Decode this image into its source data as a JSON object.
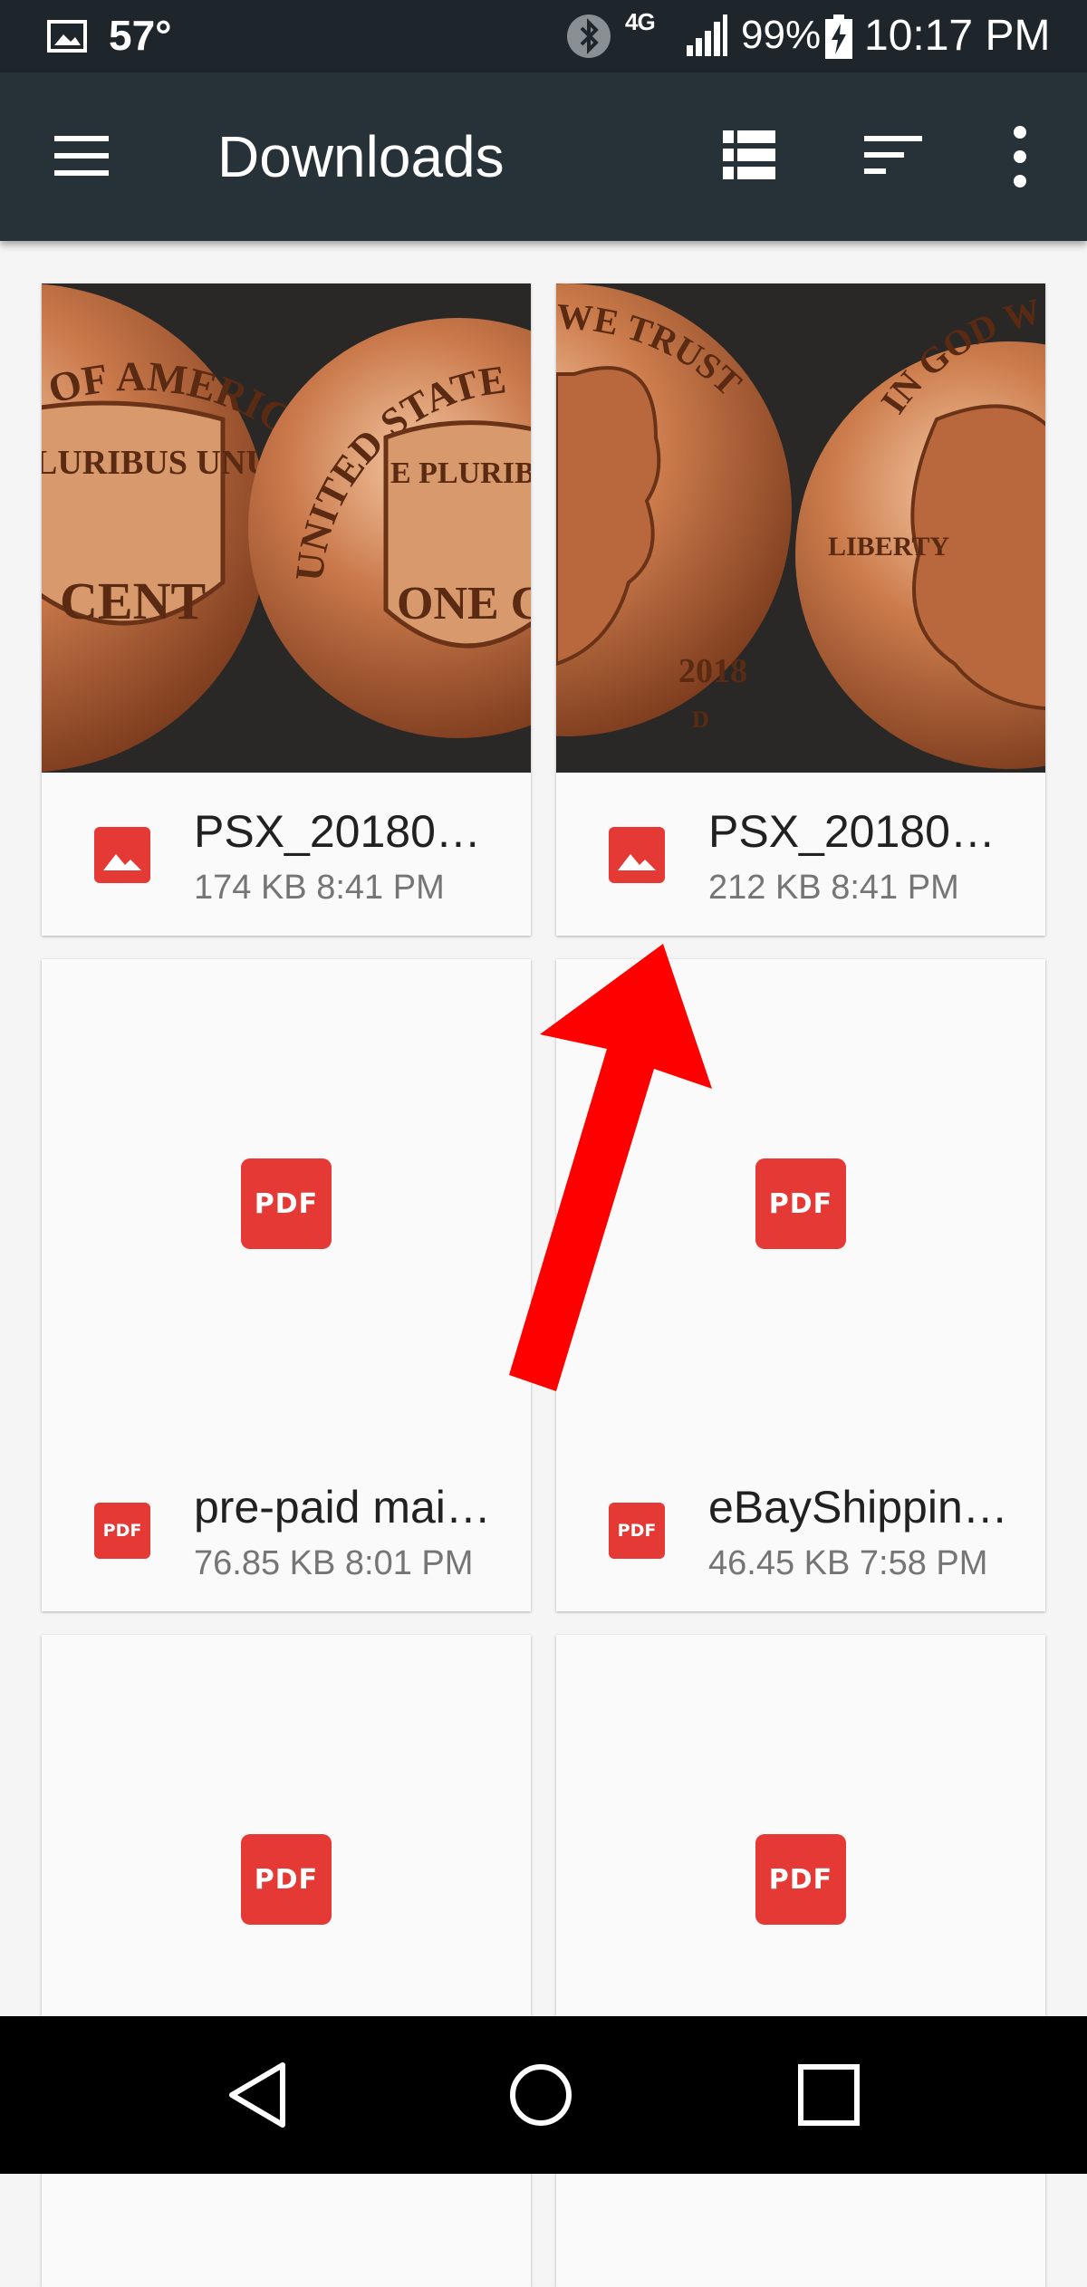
{
  "status_bar": {
    "temperature": "57°",
    "network": "4G",
    "battery_pct": "99%",
    "time": "10:17 PM",
    "icons": [
      "image-icon",
      "bluetooth-icon",
      "signal-icon",
      "battery-charging-icon"
    ]
  },
  "app_bar": {
    "title": "Downloads",
    "icons": [
      "menu-icon",
      "list-view-icon",
      "sort-icon",
      "more-vert-icon"
    ]
  },
  "files": [
    {
      "name": "PSX_20180…",
      "size": "174 KB",
      "time": "8:41 PM",
      "type": "image",
      "thumb": "penny-reverse"
    },
    {
      "name": "PSX_20180…",
      "size": "212 KB",
      "time": "8:41 PM",
      "type": "image",
      "thumb": "penny-obverse"
    },
    {
      "name": "pre-paid mai…",
      "size": "76.85 KB",
      "time": "8:01 PM",
      "type": "pdf"
    },
    {
      "name": "eBayShippin…",
      "size": "46.45 KB",
      "time": "7:58 PM",
      "type": "pdf"
    },
    {
      "name": "",
      "size": "",
      "time": "",
      "type": "pdf"
    },
    {
      "name": "",
      "size": "",
      "time": "",
      "type": "pdf"
    }
  ],
  "pdf_badge": "PDF",
  "coin_text": {
    "left_top": "ES OF AMERICA",
    "left_motto": "LURIBUS UNUM",
    "left_cent": "CENT",
    "right_top": "UNITED STATES",
    "right_motto": "E PLURIBUS",
    "right_cent": "ONE C",
    "obv_left_top": "WE TRUST",
    "obv_year": "2018",
    "obv_mint": "D",
    "obv_right_top": "IN GOD W",
    "obv_liberty": "LIBERTY"
  },
  "colors": {
    "status_bar": "#1e262c",
    "app_bar": "#263238",
    "pdf_red": "#e53935",
    "arrow_red": "#ff0000",
    "nav_bar": "#000000"
  },
  "nav_bar": {
    "icons": [
      "back-icon",
      "home-icon",
      "recents-icon"
    ]
  }
}
